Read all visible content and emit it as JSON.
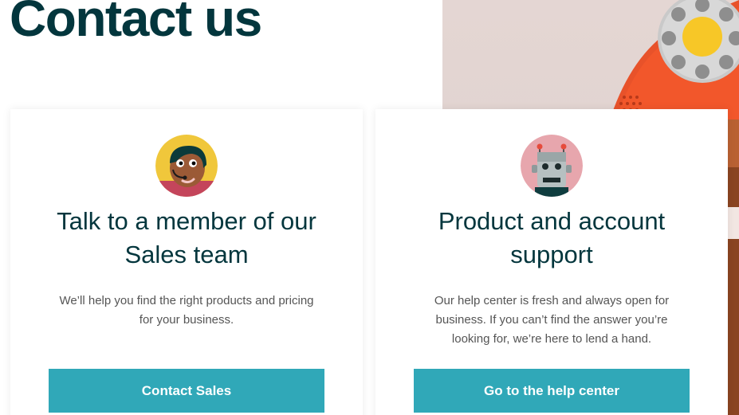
{
  "page": {
    "title": "Contact us"
  },
  "sales_card": {
    "avatar_icon": "sales-agent-headset-icon",
    "title_lines": [
      "Talk to a member of our",
      "Sales team"
    ],
    "body_lines": [
      "We’ll help you find the right products and pricing",
      "for your business."
    ],
    "button_label": "Contact Sales"
  },
  "support_card": {
    "avatar_icon": "support-robot-icon",
    "title_lines": [
      "Product and account",
      "support"
    ],
    "body_lines": [
      "Our help center is fresh and always open for",
      "business. If you can’t find the answer you’re",
      "looking for, we’re here to lend a hand."
    ],
    "button_label": "Go to the help center"
  },
  "colors": {
    "title": "#03363d",
    "body_text": "#555555",
    "button_bg": "#30a8b8",
    "button_text": "#ffffff",
    "phone_orange": "#f2572b",
    "dial_yellow": "#f7c727"
  }
}
